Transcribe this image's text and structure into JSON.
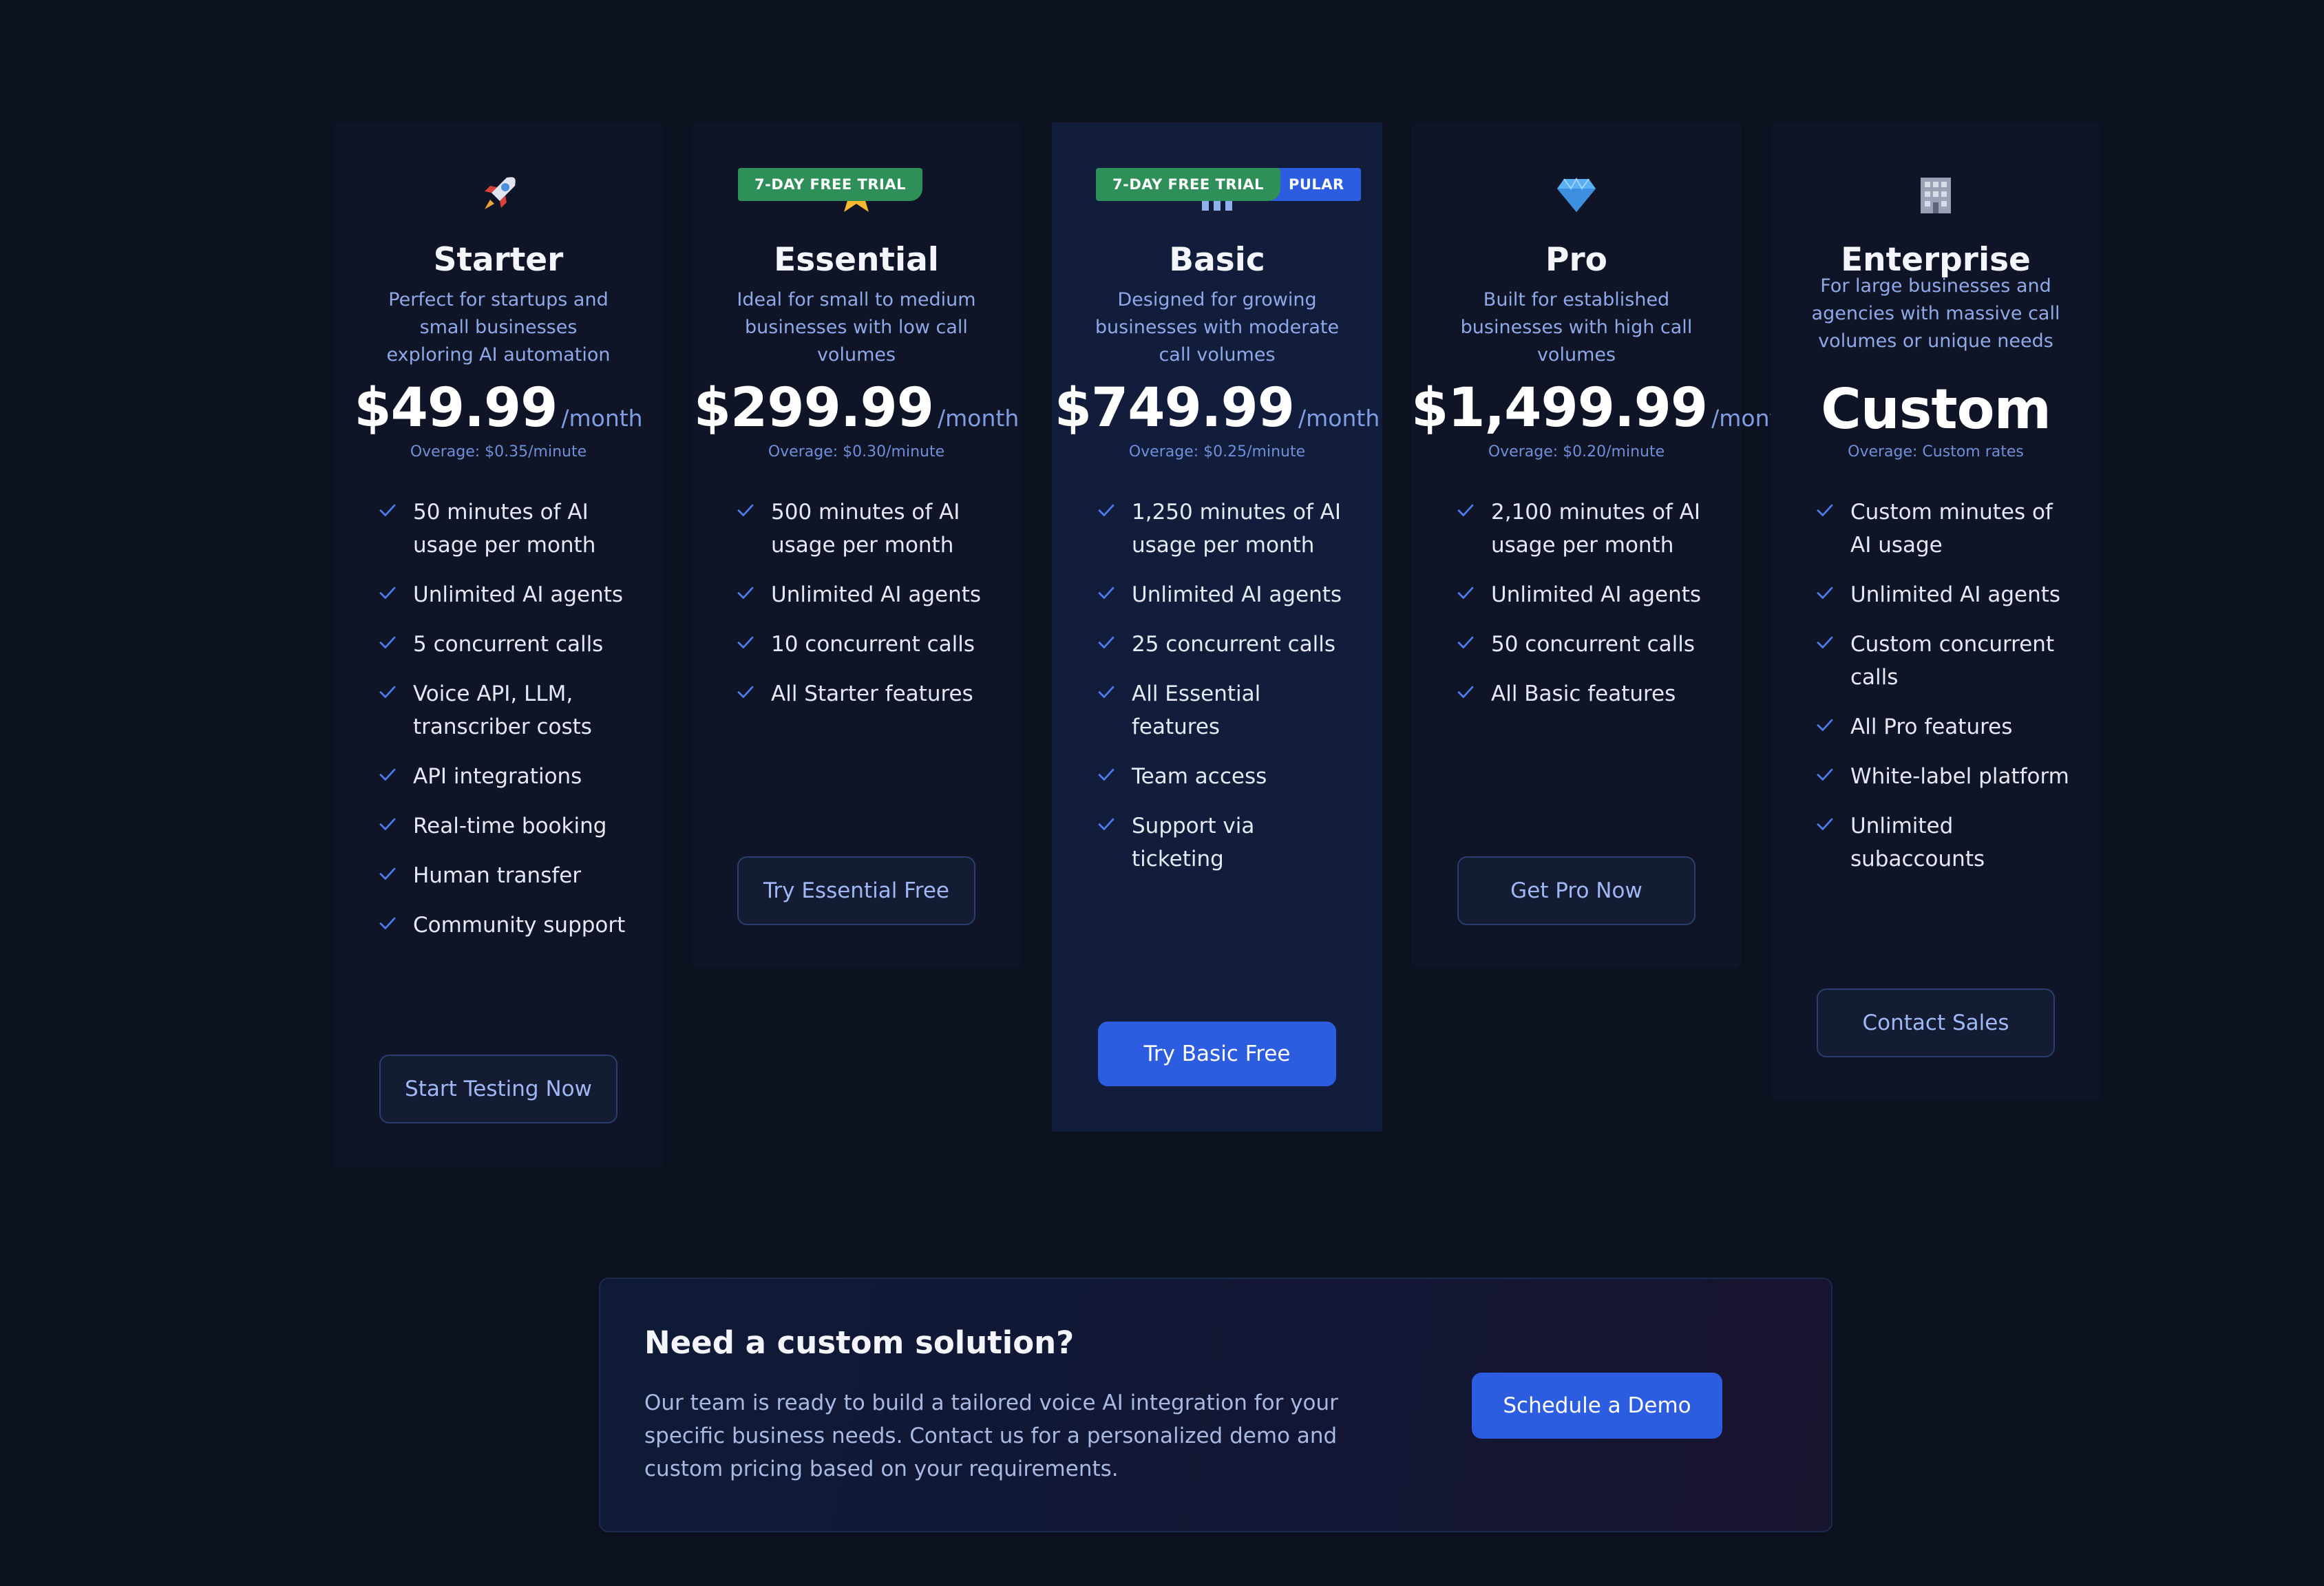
{
  "plans": [
    {
      "icon": "rocket-icon",
      "name": "Starter",
      "description": "Perfect for startups and small businesses exploring AI automation",
      "price": "$49.99",
      "period": "/month",
      "overage": "Overage: $0.35/minute",
      "features": [
        "50 minutes of AI usage per month",
        "Unlimited AI agents",
        "5 concurrent calls",
        "Voice API, LLM, transcriber costs",
        "API integrations",
        "Real-time booking",
        "Human transfer",
        "Community support"
      ],
      "cta": "Start Testing Now"
    },
    {
      "icon": "star-icon",
      "badge": "7-DAY FREE TRIAL",
      "name": "Essential",
      "description": "Ideal for small to medium businesses with low call volumes",
      "price": "$299.99",
      "period": "/month",
      "overage": "Overage: $0.30/minute",
      "features": [
        "500 minutes of AI usage per month",
        "Unlimited AI agents",
        "10 concurrent calls",
        "All Starter features"
      ],
      "cta": "Try Essential Free"
    },
    {
      "icon": "chart-icon",
      "badge": "7-DAY FREE TRIAL",
      "badge_secondary": "PULAR",
      "name": "Basic",
      "description": "Designed for growing businesses with moderate call volumes",
      "price": "$749.99",
      "period": "/month",
      "overage": "Overage: $0.25/minute",
      "features": [
        "1,250 minutes of AI usage per month",
        "Unlimited AI agents",
        "25 concurrent calls",
        "All Essential features",
        "Team access",
        "Support via ticketing"
      ],
      "cta": "Try Basic Free"
    },
    {
      "icon": "diamond-icon",
      "name": "Pro",
      "description": "Built for established businesses with high call volumes",
      "price": "$1,499.99",
      "period": "/month",
      "overage": "Overage: $0.20/minute",
      "features": [
        "2,100 minutes of AI usage per month",
        "Unlimited AI agents",
        "50 concurrent calls",
        "All Basic features"
      ],
      "cta": "Get Pro Now"
    },
    {
      "icon": "office-building-icon",
      "name": "Enterprise",
      "description": "For large businesses and agencies with massive call volumes or unique needs",
      "price": "Custom",
      "overage": "Overage: Custom rates",
      "features": [
        "Custom minutes of AI usage",
        "Unlimited AI agents",
        "Custom concurrent calls",
        "All Pro features",
        "White-label platform",
        "Unlimited subaccounts"
      ],
      "cta": "Contact Sales"
    }
  ],
  "custom_solution": {
    "title": "Need a custom solution?",
    "body": "Our team is ready to build a tailored voice AI integration for your specific business needs. Contact us for a personalized demo and custom pricing based on your requirements.",
    "cta": "Schedule a Demo"
  },
  "colors": {
    "background": "#0c1120",
    "card": "#0f1526",
    "featured_card": "#111d3a",
    "accent": "#2c5ce0",
    "trial_badge": "#2f8f58"
  }
}
